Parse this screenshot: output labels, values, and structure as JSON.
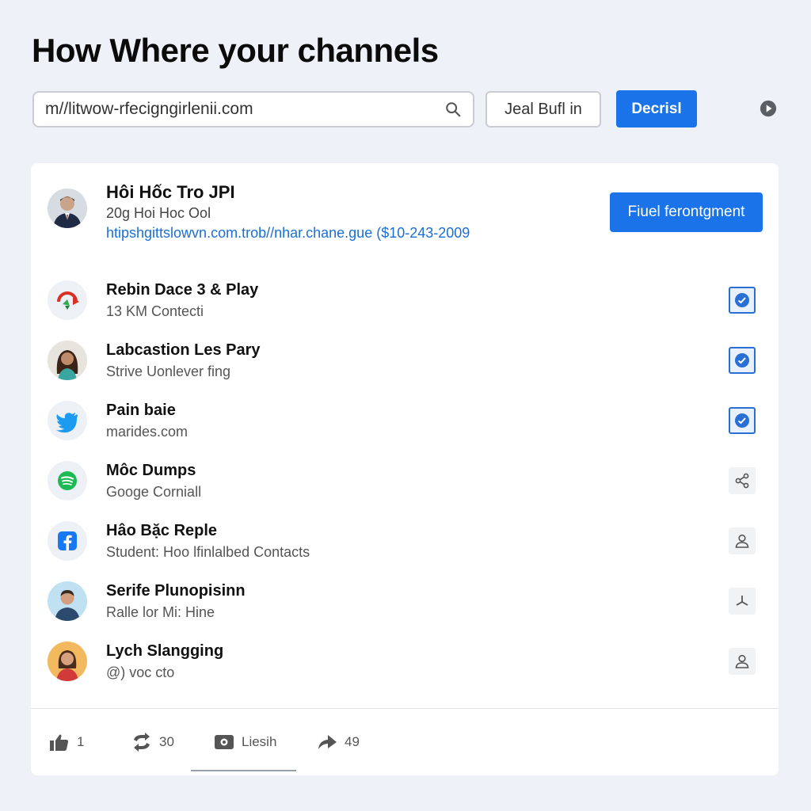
{
  "header": {
    "title": "How Where your channels",
    "search_value": "m//litwow-rfecigngirlenii.com",
    "outline_button": "Jeal Bufl in",
    "primary_button": "Decrisl"
  },
  "profile": {
    "name": "Hôi Hốc Tro JPI",
    "subtitle": "20g Hoi Hoc Ool",
    "link": "htipshgittslowvn.com.trob//nhar.chane.gue ($10-243-2009",
    "follow_button": "Fiuel ferontgment"
  },
  "items": [
    {
      "title": "Rebin Dace 3 & Play",
      "subtitle": "13 KM Contecti",
      "icon": "google-play-icon",
      "action": "check-icon"
    },
    {
      "title": "Labcastion Les Pary",
      "subtitle": "Strive Uonlever fing",
      "icon": "avatar-woman-icon",
      "action": "check-icon"
    },
    {
      "title": "Pain baie",
      "subtitle": "marides.com",
      "icon": "twitter-icon",
      "action": "check-icon"
    },
    {
      "title": "Môc Dumps",
      "subtitle": "Googe Corniall",
      "icon": "spotify-icon",
      "action": "share-icon"
    },
    {
      "title": "Hâo Bặc Reple",
      "subtitle": "Student: Hoo lfinlalbed Contacts",
      "icon": "facebook-icon",
      "action": "person-icon"
    },
    {
      "title": "Serife Plunopisinn",
      "subtitle": "Ralle lor Mi: Hine",
      "icon": "avatar-man-icon",
      "action": "pin-icon"
    },
    {
      "title": "Lych Slangging",
      "subtitle": "@) voc cto",
      "icon": "avatar-woman-icon",
      "action": "person-icon"
    }
  ],
  "footer": {
    "likes": "1",
    "reposts": "30",
    "tab_label": "Liesih",
    "shares": "49"
  },
  "colors": {
    "accent": "#1a73e8",
    "background": "#eef2f8",
    "link": "#1a6fd6"
  }
}
